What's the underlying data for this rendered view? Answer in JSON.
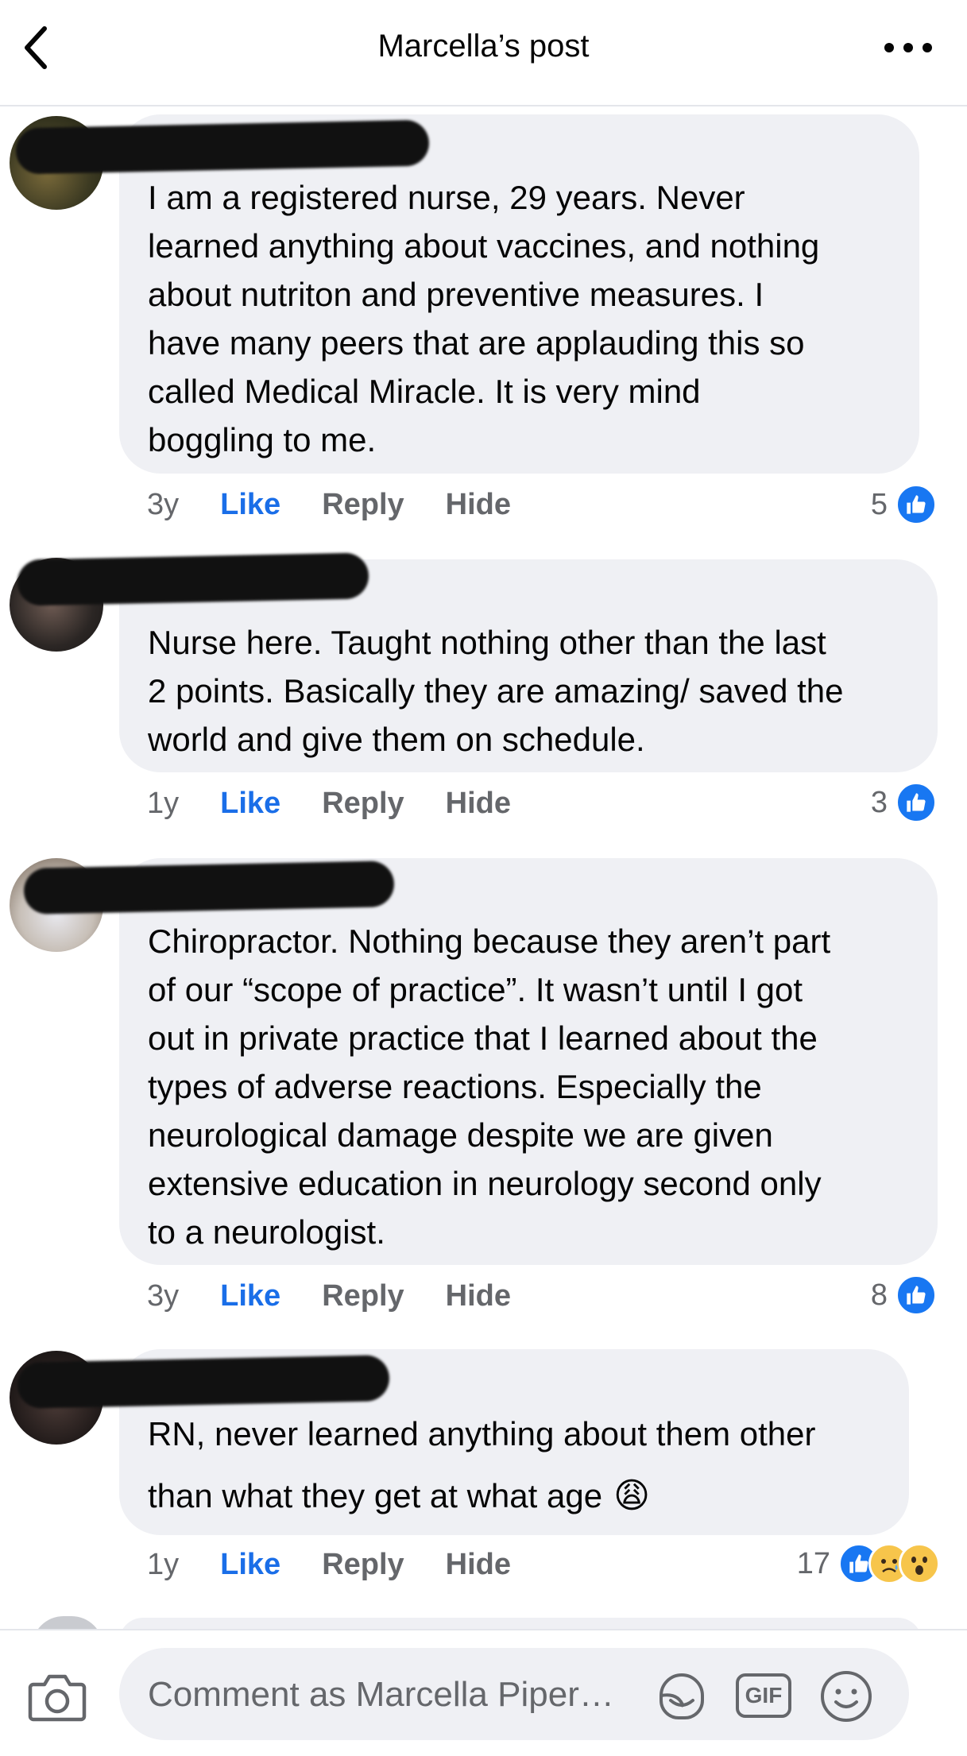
{
  "header": {
    "title": "Marcella’s post"
  },
  "comments": [
    {
      "text": "I am a registered nurse, 29 years.  Never\nlearned anything about vaccines, and nothing\nabout nutriton and preventive measures.  I\nhave many peers that are applauding this so\ncalled Medical Miracle.  It is very mind\nboggling to me.",
      "time": "3y",
      "like": "Like",
      "reply": "Reply",
      "hide": "Hide",
      "reaction_count": "5"
    },
    {
      "text": "Nurse here. Taught nothing other than the last\n2 points. Basically they are amazing/ saved the\nworld and give them on schedule.",
      "time": "1y",
      "like": "Like",
      "reply": "Reply",
      "hide": "Hide",
      "reaction_count": "3"
    },
    {
      "text": "Chiropractor. Nothing because they aren’t part\nof our “scope of practice”.   It wasn’t until I got\nout in private practice that I learned about the\ntypes of adverse reactions.  Especially the\nneurological damage despite we are given\nextensive education in neurology second only\nto a neurologist.",
      "time": "3y",
      "like": "Like",
      "reply": "Reply",
      "hide": "Hide",
      "reaction_count": "8"
    },
    {
      "text_line1": "RN, never learned anything about them other",
      "text_line2": "than what they get at what age",
      "emoji": "😩",
      "time": "1y",
      "like": "Like",
      "reply": "Reply",
      "hide": "Hide",
      "reaction_count": "17"
    }
  ],
  "composer": {
    "placeholder": "Comment as Marcella Piper…",
    "gif_label": "GIF"
  },
  "colors": {
    "accent": "#1a6ee8",
    "bubble": "#eff0f4",
    "muted": "#65676b"
  }
}
